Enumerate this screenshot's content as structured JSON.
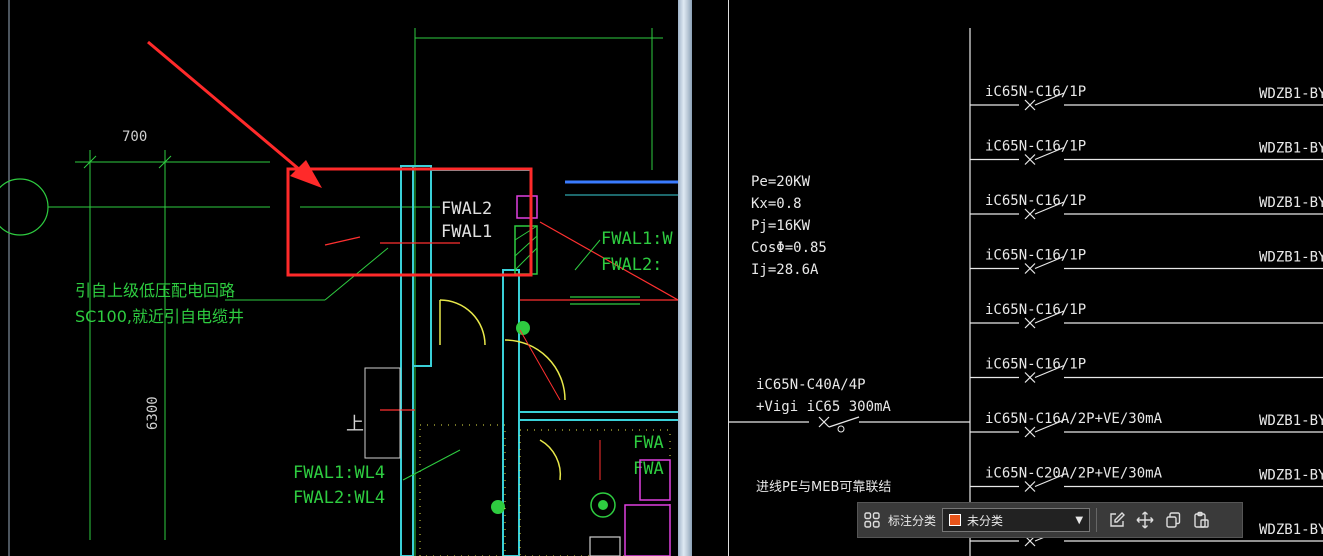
{
  "left_drawing": {
    "dimension_top": "700",
    "dimension_side": "6300",
    "fwal2_label": "FWAL2",
    "fwal1_label": "FWAL1",
    "fwal1_right": "FWAL1:W",
    "fwal2_right": "FWAL2:",
    "note_line1": "引自上级低压配电回路",
    "note_line2": "SC100,就近引自电缆井",
    "bottom_line1": "FWAL1:WL4",
    "bottom_line2": "FWAL2:WL4",
    "fwa_a": "FWA",
    "fwa_b": "FWA",
    "up_mark": "上"
  },
  "right_drawing": {
    "params": [
      "Pe=20KW",
      "Kx=0.8",
      "Pj=16KW",
      "CosΦ=0.85",
      "Ij=28.6A"
    ],
    "main_breaker_line1": "iC65N-C40A/4P",
    "main_breaker_line2": "+Vigi iC65 300mA",
    "pe_note": "进线PE与MEB可靠联结",
    "circuits": [
      {
        "breaker": "iC65N-C16/1P",
        "cable": "WDZB1-BY"
      },
      {
        "breaker": "iC65N-C16/1P",
        "cable": "WDZB1-BY"
      },
      {
        "breaker": "iC65N-C16/1P",
        "cable": "WDZB1-BY"
      },
      {
        "breaker": "iC65N-C16/1P",
        "cable": "WDZB1-BY"
      },
      {
        "breaker": "iC65N-C16/1P",
        "cable": ""
      },
      {
        "breaker": "iC65N-C16/1P",
        "cable": ""
      },
      {
        "breaker": "iC65N-C16A/2P+VE/30mA",
        "cable": "WDZB1-BY"
      },
      {
        "breaker": "iC65N-C20A/2P+VE/30mA",
        "cable": "WDZB1-BY"
      },
      {
        "breaker": "",
        "cable": "WDZB1-BY"
      }
    ]
  },
  "toolbar": {
    "label": "标注分类",
    "selected": "未分类",
    "swatch_color": "#e8541a",
    "icons": [
      "grid-icon",
      "edit-icon",
      "move-icon",
      "copy-icon",
      "paste-icon"
    ]
  }
}
